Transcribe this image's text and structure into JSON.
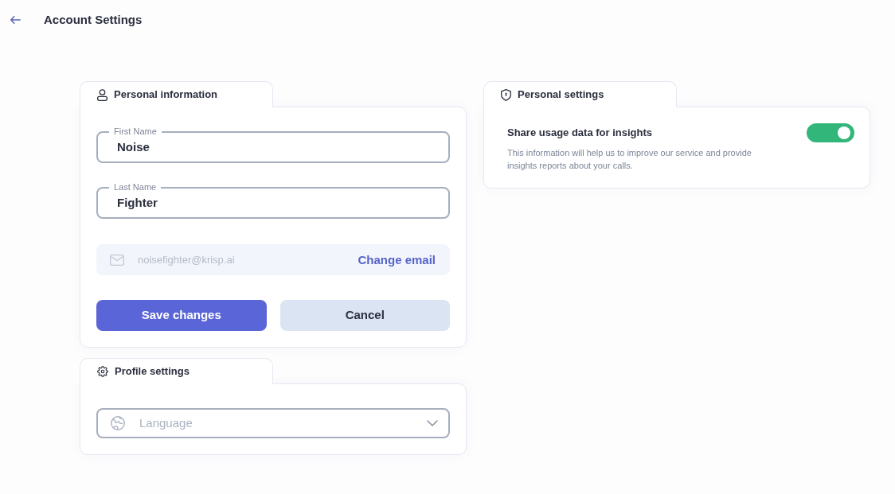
{
  "header": {
    "title": "Account Settings"
  },
  "personal_information": {
    "title": "Personal information",
    "fields": [
      {
        "label": "First Name",
        "value": "Noise"
      },
      {
        "label": "Last Name",
        "value": "Fighter"
      }
    ],
    "email": {
      "value": "noisefighter@krisp.ai",
      "disabled": true,
      "action": "Change email"
    },
    "buttons": [
      {
        "label": "Save changes",
        "kind": "primary"
      },
      {
        "label": "Cancel",
        "kind": "secondary"
      }
    ]
  },
  "profile_settings": {
    "title": "Profile settings",
    "language": {
      "placeholder": "Language"
    }
  },
  "personal_settings": {
    "title": "Personal settings",
    "items": [
      {
        "label": "Share usage data for insights",
        "description": "This information will help us to improve our service and provide insights reports about your calls.",
        "on": true
      }
    ]
  }
}
